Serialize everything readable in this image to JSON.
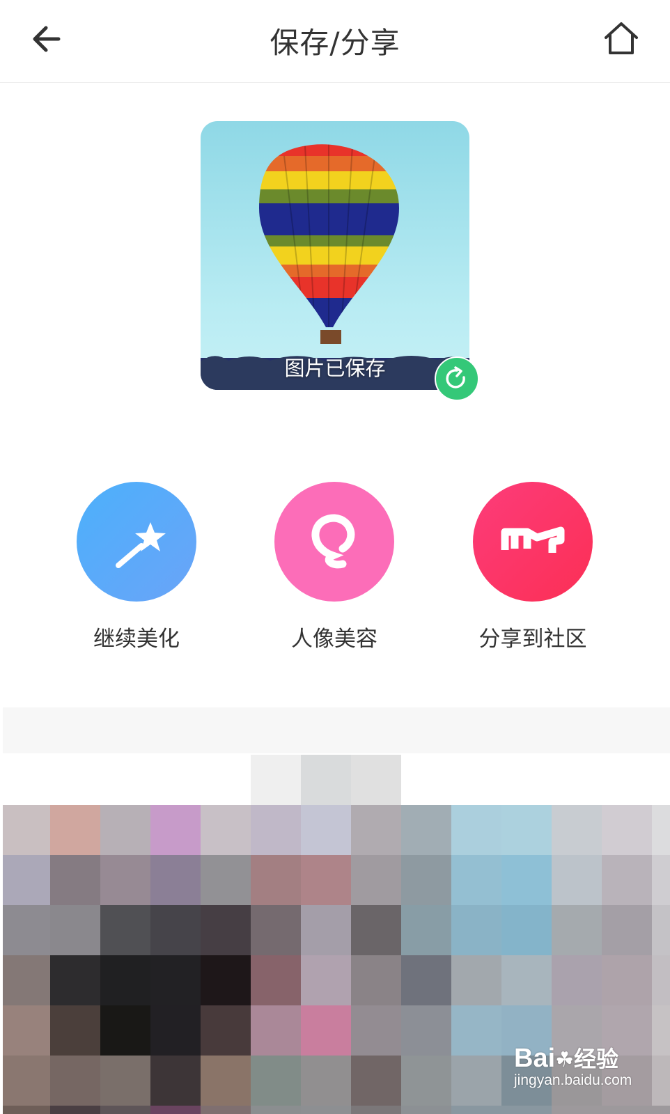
{
  "header": {
    "title": "保存/分享"
  },
  "preview": {
    "status_text": "图片已保存"
  },
  "actions": [
    {
      "label": "继续美化",
      "icon": "magic-wand-icon",
      "color": "#5aa8fb"
    },
    {
      "label": "人像美容",
      "icon": "face-outline-icon",
      "color": "#fb6db8"
    },
    {
      "label": "分享到社区",
      "icon": "meitu-logo-icon",
      "color": "#fb3a6a"
    }
  ],
  "watermark": {
    "brand": "Bai",
    "brand_cn": "经验",
    "url": "jingyan.baidu.com"
  },
  "colors": {
    "share_badge": "#34c878",
    "title_text": "#333333"
  }
}
